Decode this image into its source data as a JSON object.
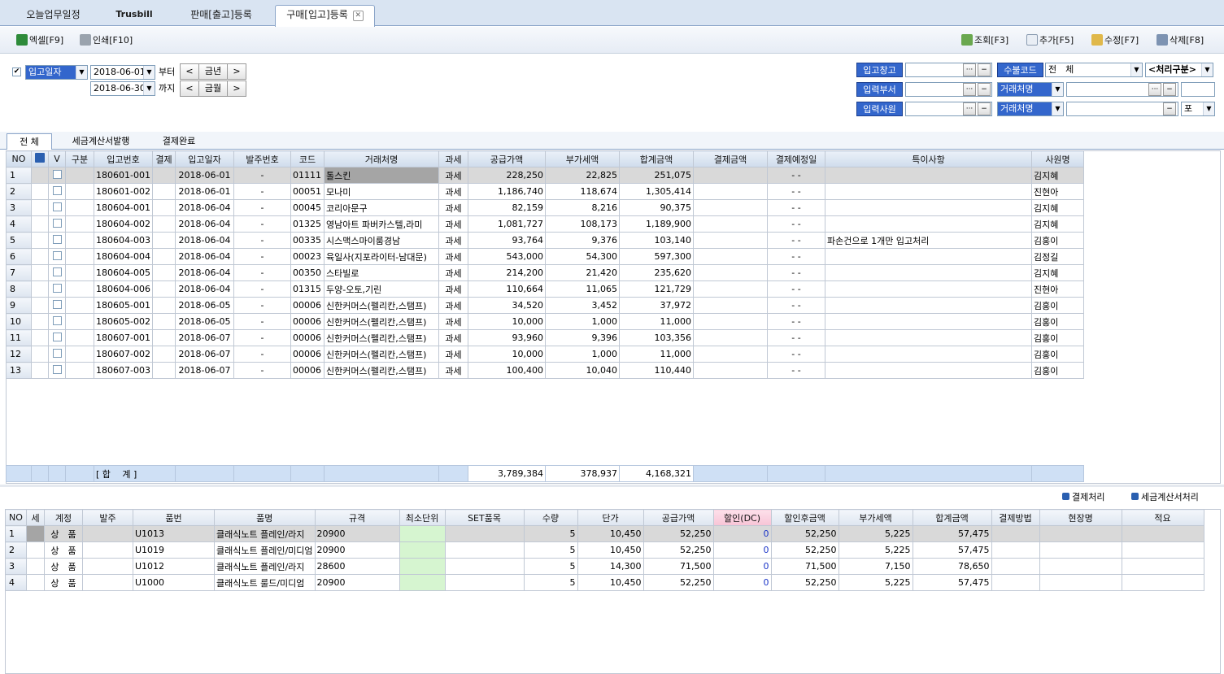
{
  "tabs": [
    "오늘업무일정",
    "Trusbill",
    "판매[출고]등록",
    "구매[입고]등록"
  ],
  "toolbar": {
    "excel": "엑셀[F9]",
    "print": "인쇄[F10]",
    "search": "조회[F3]",
    "add": "추가[F5]",
    "edit": "수정[F7]",
    "delete": "삭제[F8]"
  },
  "filter": {
    "date_type": "입고일자",
    "date_from": "2018-06-01",
    "date_to": "2018-06-30",
    "from_label": "부터",
    "to_label": "까지",
    "prev": "<",
    "next": ">",
    "year_label": "금년",
    "month_label": "금월",
    "warehouse_label": "입고창고",
    "inout_code_label": "수불코드",
    "inout_code_value": "전　체",
    "process_label": "<처리구분>",
    "dept_label": "입력부서",
    "client_label1": "거래처명",
    "staff_label": "입력사원",
    "client_label2": "거래처명",
    "po_value": "포",
    "dots": "···",
    "minus": "−"
  },
  "subtabs": [
    "전 체",
    "세금계산서발행",
    "결제완료"
  ],
  "grid1": {
    "headers": [
      "NO",
      "",
      "V",
      "구분",
      "입고번호",
      "결제",
      "입고일자",
      "발주번호",
      "코드",
      "거래처명",
      "과세",
      "공급가액",
      "부가세액",
      "합계금액",
      "결제금액",
      "결제예정일",
      "특이사항",
      "사원명"
    ],
    "rows": [
      [
        "1",
        "180601-001",
        "2018-06-01",
        "-",
        "01111",
        "톨스킨",
        "과세",
        "228,250",
        "22,825",
        "251,075",
        "-  -",
        "",
        "김지혜"
      ],
      [
        "2",
        "180601-002",
        "2018-06-01",
        "-",
        "00051",
        "모나미",
        "과세",
        "1,186,740",
        "118,674",
        "1,305,414",
        "-  -",
        "",
        "진현아"
      ],
      [
        "3",
        "180604-001",
        "2018-06-04",
        "-",
        "00045",
        "코리아문구",
        "과세",
        "82,159",
        "8,216",
        "90,375",
        "-  -",
        "",
        "김지혜"
      ],
      [
        "4",
        "180604-002",
        "2018-06-04",
        "-",
        "01325",
        "영남아트 파버카스텔,라미",
        "과세",
        "1,081,727",
        "108,173",
        "1,189,900",
        "-  -",
        "",
        "김지혜"
      ],
      [
        "5",
        "180604-003",
        "2018-06-04",
        "-",
        "00335",
        "시스맥스마이룸경남",
        "과세",
        "93,764",
        "9,376",
        "103,140",
        "-  -",
        "파손건으로 1개만 입고처리",
        "김홍이"
      ],
      [
        "6",
        "180604-004",
        "2018-06-04",
        "-",
        "00023",
        "육일사(지포라이터-남대문)",
        "과세",
        "543,000",
        "54,300",
        "597,300",
        "-  -",
        "",
        "김정길"
      ],
      [
        "7",
        "180604-005",
        "2018-06-04",
        "-",
        "00350",
        "스타빌로",
        "과세",
        "214,200",
        "21,420",
        "235,620",
        "-  -",
        "",
        "김지혜"
      ],
      [
        "8",
        "180604-006",
        "2018-06-04",
        "-",
        "01315",
        "두양-오토,기린",
        "과세",
        "110,664",
        "11,065",
        "121,729",
        "-  -",
        "",
        "진현아"
      ],
      [
        "9",
        "180605-001",
        "2018-06-05",
        "-",
        "00006",
        "신한커머스(펠리칸,스탬프)",
        "과세",
        "34,520",
        "3,452",
        "37,972",
        "-  -",
        "",
        "김홍이"
      ],
      [
        "10",
        "180605-002",
        "2018-06-05",
        "-",
        "00006",
        "신한커머스(펠리칸,스탬프)",
        "과세",
        "10,000",
        "1,000",
        "11,000",
        "-  -",
        "",
        "김홍이"
      ],
      [
        "11",
        "180607-001",
        "2018-06-07",
        "-",
        "00006",
        "신한커머스(펠리칸,스탬프)",
        "과세",
        "93,960",
        "9,396",
        "103,356",
        "-  -",
        "",
        "김홍이"
      ],
      [
        "12",
        "180607-002",
        "2018-06-07",
        "-",
        "00006",
        "신한커머스(펠리칸,스탬프)",
        "과세",
        "10,000",
        "1,000",
        "11,000",
        "-  -",
        "",
        "김홍이"
      ],
      [
        "13",
        "180607-003",
        "2018-06-07",
        "-",
        "00006",
        "신한커머스(펠리칸,스탬프)",
        "과세",
        "100,400",
        "10,040",
        "110,440",
        "-  -",
        "",
        "김홍이"
      ]
    ],
    "total_label": "[ 합　 계 ]",
    "total_supply": "3,789,384",
    "total_vat": "378,937",
    "total_sum": "4,168,321"
  },
  "actions": {
    "payment": "결제처리",
    "tax_invoice": "세금계산서처리"
  },
  "grid2": {
    "headers": [
      "NO",
      "세",
      "계정",
      "발주",
      "품번",
      "품명",
      "규격",
      "최소단위",
      "SET품목",
      "수량",
      "단가",
      "공급가액",
      "할인(DC)",
      "할인후금액",
      "부가세액",
      "합계금액",
      "결제방법",
      "현장명",
      "적요"
    ],
    "rows": [
      [
        "1",
        "상　품",
        "U1013",
        "클래식노트 플레인/라지",
        "20900",
        "5",
        "10,450",
        "52,250",
        "0",
        "52,250",
        "5,225",
        "57,475"
      ],
      [
        "2",
        "상　품",
        "U1019",
        "클래식노트 플레인/미디엄",
        "20900",
        "5",
        "10,450",
        "52,250",
        "0",
        "52,250",
        "5,225",
        "57,475"
      ],
      [
        "3",
        "상　품",
        "U1012",
        "클래식노트 플레인/라지",
        "28600",
        "5",
        "14,300",
        "71,500",
        "0",
        "71,500",
        "7,150",
        "78,650"
      ],
      [
        "4",
        "상　품",
        "U1000",
        "클래식노트 룰드/미디엄",
        "20900",
        "5",
        "10,450",
        "52,250",
        "0",
        "52,250",
        "5,225",
        "57,475"
      ]
    ]
  }
}
